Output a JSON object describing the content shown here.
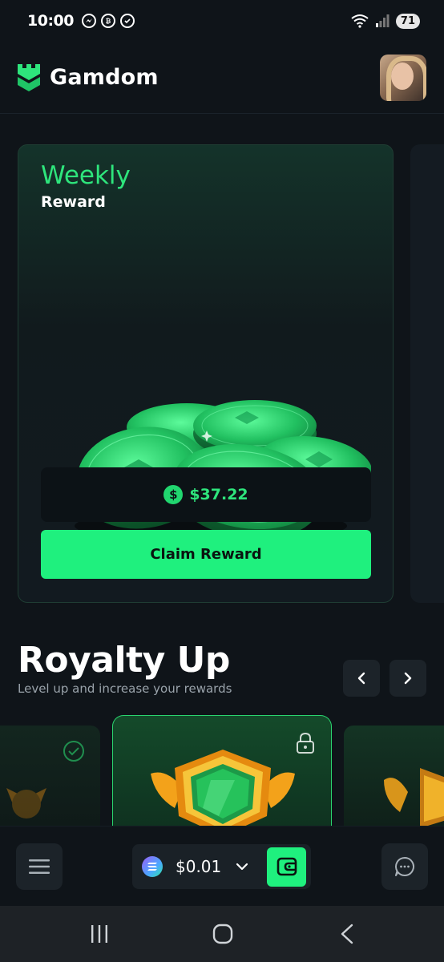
{
  "status_bar": {
    "time": "10:00",
    "battery": "71",
    "notification_icons": [
      "messenger-icon",
      "currency-icon",
      "check-circle-icon"
    ]
  },
  "header": {
    "brand": "Gamdom",
    "brand_color": "#2ee57c"
  },
  "reward_card": {
    "title": "Weekly",
    "subtitle": "Reward",
    "amount": "$37.22",
    "currency_symbol": "$",
    "claim_label": "Claim Reward",
    "accent": "#1ff07e"
  },
  "royalty": {
    "title": "Royalty Up",
    "subtitle": "Level up and increase your rewards",
    "tiers": [
      {
        "state": "completed",
        "icon": "check-circle-icon"
      },
      {
        "state": "locked",
        "icon": "lock-icon"
      },
      {
        "state": "upcoming",
        "icon": "badge-icon"
      }
    ]
  },
  "bottom_bar": {
    "balance": "$0.01",
    "currency_icon": "solana-icon"
  },
  "colors": {
    "background": "#0f1419",
    "card": "#121a20",
    "accent": "#1ff07e",
    "accent_text": "#2ee57c"
  }
}
